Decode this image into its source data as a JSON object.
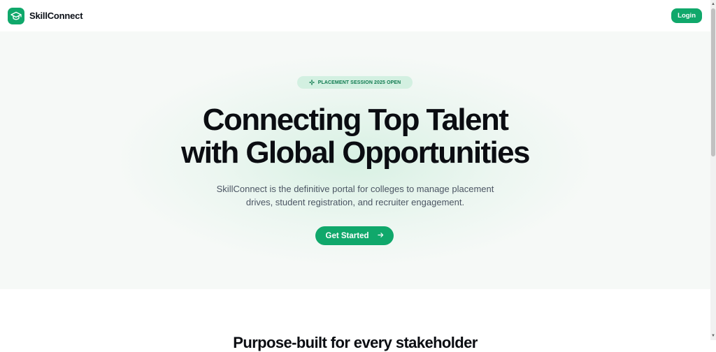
{
  "nav": {
    "brand_name": "SkillConnect",
    "logo_icon": "graduation-cap-icon",
    "login_label": "Login"
  },
  "hero": {
    "badge_icon": "sparkle-icon",
    "badge_text": "PLACEMENT SESSION 2025 OPEN",
    "title_line1": "Connecting Top Talent",
    "title_line2": "with Global Opportunities",
    "subtitle_line1": "SkillConnect is the definitive portal for colleges to manage placement",
    "subtitle_line2": "drives, student registration, and recruiter engagement.",
    "cta_label": "Get Started",
    "cta_icon": "arrow-right-icon"
  },
  "next_section": {
    "heading": "Purpose-built for every stakeholder"
  },
  "colors": {
    "accent": "#10a86b",
    "badge_bg": "#d3f0e1",
    "badge_text": "#0f7a4f",
    "hero_bg": "#f6f9f7"
  }
}
